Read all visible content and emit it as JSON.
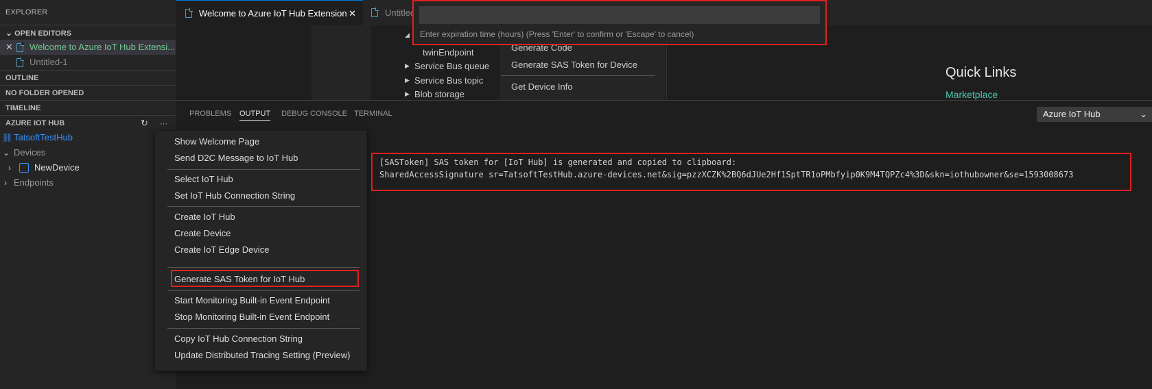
{
  "sidebar": {
    "title": "EXPLORER",
    "open_editors": "OPEN EDITORS",
    "open_editor_items": [
      "Welcome to Azure IoT Hub Extensi...",
      "Untitled-1"
    ],
    "outline": "OUTLINE",
    "no_folder": "NO FOLDER OPENED",
    "timeline": "TIMELINE",
    "azure_iot_hub": "AZURE IOT HUB",
    "more_actions": "···",
    "hub_name": "TatsoftTestHub",
    "devices": "Devices",
    "device_name": "NewDevice",
    "endpoints": "Endpoints"
  },
  "tabs": {
    "active": "Welcome to Azure IoT Hub Extension",
    "inactive": "Untitled"
  },
  "editor": {
    "tree": [
      "twinEndpoint",
      "Service Bus queue",
      "Service Bus topic",
      "Blob storage"
    ],
    "menu": [
      "Generate Code",
      "Generate SAS Token for Device",
      "Get Device Info"
    ],
    "quick_links_title": "Quick Links",
    "quick_links_item": "Marketplace"
  },
  "quickpick": {
    "value": "",
    "hint": "Enter expiration time (hours) (Press 'Enter' to confirm or 'Escape' to cancel)"
  },
  "panel": {
    "tabs": [
      "PROBLEMS",
      "OUTPUT",
      "DEBUG CONSOLE",
      "TERMINAL"
    ],
    "output_channel": "Azure IoT Hub",
    "output_line1": "[SASToken] SAS token for [IoT Hub] is generated and copied to clipboard:",
    "output_line2": "SharedAccessSignature sr=TatsoftTestHub.azure-devices.net&sig=pzzXCZK%2BQ6dJUe2Hf1SptTR1oPMbfyip0K9M4TQPZc4%3D&skn=iothubowner&se=1593008673"
  },
  "context_menu": {
    "items": [
      "Show Welcome Page",
      "Send D2C Message to IoT Hub",
      "Select IoT Hub",
      "Set IoT Hub Connection String",
      "Create IoT Hub",
      "Create Device",
      "Create IoT Edge Device",
      "Generate SAS Token for IoT Hub",
      "Start Monitoring Built-in Event Endpoint",
      "Stop Monitoring Built-in Event Endpoint",
      "Copy IoT Hub Connection String",
      "Update Distributed Tracing Setting (Preview)"
    ]
  },
  "colors": {
    "highlight_border": "#e02020",
    "accent": "#0078d4",
    "link": "#4ec9b0"
  }
}
